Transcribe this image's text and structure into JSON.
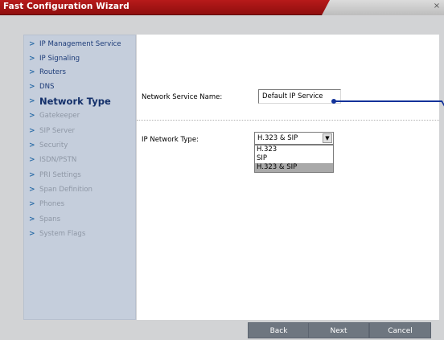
{
  "window": {
    "title": "Fast Configuration Wizard",
    "close_glyph": "×"
  },
  "sidebar": {
    "items": [
      {
        "label": "IP Management Service",
        "state": "done"
      },
      {
        "label": "IP Signaling",
        "state": "done"
      },
      {
        "label": "Routers",
        "state": "done"
      },
      {
        "label": "DNS",
        "state": "done"
      },
      {
        "label": "Network Type",
        "state": "active"
      },
      {
        "label": "Gatekeeper",
        "state": "todo"
      },
      {
        "label": "SIP Server",
        "state": "todo"
      },
      {
        "label": "Security",
        "state": "todo"
      },
      {
        "label": "ISDN/PSTN",
        "state": "todo"
      },
      {
        "label": "PRI Settings",
        "state": "todo"
      },
      {
        "label": "Span Definition",
        "state": "todo"
      },
      {
        "label": "Phones",
        "state": "todo"
      },
      {
        "label": "Spans",
        "state": "todo"
      },
      {
        "label": "System Flags",
        "state": "todo"
      }
    ],
    "chevron": ">"
  },
  "form": {
    "network_service_name": {
      "label": "Network Service Name:",
      "value": "Default IP Service"
    },
    "ip_network_type": {
      "label": "IP Network Type:",
      "selected": "H.323 & SIP",
      "dropdown_arrow": "▼",
      "options": [
        "H.323",
        "SIP",
        "H.323 & SIP"
      ]
    }
  },
  "buttons": {
    "back": "Back",
    "next": "Next",
    "cancel": "Cancel"
  },
  "colors": {
    "titlebar": "#a51515",
    "sidebar_bg": "#c5cedc",
    "active_text": "#14306a",
    "todo_text": "#8e97a5",
    "button_bg": "#6e7680",
    "pointer": "#12329a"
  }
}
